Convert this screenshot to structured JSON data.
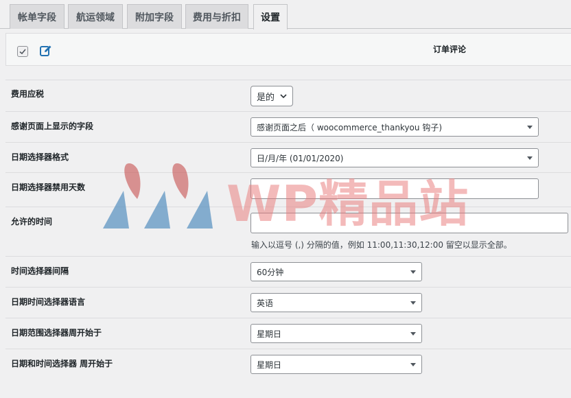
{
  "tabs": [
    {
      "label": "帐单字段"
    },
    {
      "label": "航运领域"
    },
    {
      "label": "附加字段"
    },
    {
      "label": "费用与折扣"
    },
    {
      "label": "设置",
      "active": true
    }
  ],
  "toolbar": {
    "column_title": "订单评论",
    "icons": [
      "checkbox-icon",
      "edit-icon"
    ]
  },
  "settings": [
    {
      "label": "费用应税",
      "control": "select",
      "value": "是的"
    },
    {
      "label": "感谢页面上显示的字段",
      "control": "select",
      "value": "感谢页面之后（ woocommerce_thankyou 钩子)"
    },
    {
      "label": "日期选择器格式",
      "control": "select",
      "value": "日/月/年 (01/01/2020)"
    },
    {
      "label": "日期选择器禁用天数",
      "control": "input",
      "value": ""
    },
    {
      "label": "允许的时间",
      "control": "input",
      "value": "",
      "help": "输入以逗号 (,) 分隔的值，例如 11:00,11:30,12:00 留空以显示全部。"
    },
    {
      "label": "时间选择器间隔",
      "control": "select",
      "value": "60分钟"
    },
    {
      "label": "日期时间选择器语言",
      "control": "select",
      "value": "英语"
    },
    {
      "label": "日期范围选择器周开始于",
      "control": "select",
      "value": "星期日"
    },
    {
      "label": "日期和时间选择器 周开始于",
      "control": "select",
      "value": "星期日"
    }
  ],
  "watermark": {
    "text": "WP精品站"
  },
  "colors": {
    "accent": "#2271b1",
    "border": "#8c8f94",
    "background": "#f0f0f1"
  }
}
